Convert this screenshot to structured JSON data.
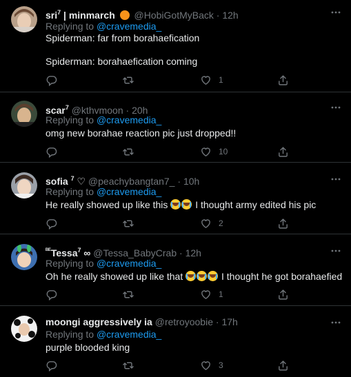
{
  "colors": {
    "background": "#000000",
    "divider": "#2f3336",
    "mention": "#1d9bf0",
    "secondary_text": "#71767b",
    "primary_text": "#e7e9ea",
    "handle_badge": "#f7931a"
  },
  "icons": {
    "reply": "reply-icon",
    "retweet": "retweet-icon",
    "like": "heart-icon",
    "share": "share-icon",
    "more": "more-icon"
  },
  "tweets": [
    {
      "name": "sri",
      "name_sup": "7",
      "name_suffix": "| minmarch",
      "handle": "@HobiGotMyBack",
      "time": "12h",
      "replying_label": "Replying to",
      "replying_to": "@cravemedia_",
      "text_line1": "Spiderman: far from borahaefication",
      "text_line2": "Spiderman: borahaefication coming",
      "likes": "1"
    },
    {
      "name": "scar",
      "name_sup": "7",
      "handle": "@kthvmoon",
      "time": "20h",
      "replying_label": "Replying to",
      "replying_to": "@cravemedia_",
      "text": "omg new borahae reaction pic just dropped!!",
      "likes": "10"
    },
    {
      "name": "sofia",
      "name_sup": "7",
      "name_heart": "♡",
      "handle": "@peachybangtan7_",
      "time": "10h",
      "replying_label": "Replying to",
      "replying_to": "@cravemedia_",
      "text_before": "He really showed up like this",
      "text_after": "I thought army edited his pic",
      "likes": "2"
    },
    {
      "name_prefix": "ᴮᴱ",
      "name": "Tessa",
      "name_sup": "7",
      "name_suffix": "∞",
      "handle": "@Tessa_BabyCrab",
      "time": "12h",
      "replying_label": "Replying to",
      "replying_to": "@cravemedia_",
      "text_before": "Oh he really showed up like that",
      "text_after": "I thought he got borahaefied",
      "likes": "1"
    },
    {
      "name": "moongi aggressively ia",
      "handle": "@retroyoobie",
      "time": "17h",
      "replying_label": "Replying to",
      "replying_to": "@cravemedia_",
      "text": "purple blooded king",
      "likes": "3"
    }
  ]
}
